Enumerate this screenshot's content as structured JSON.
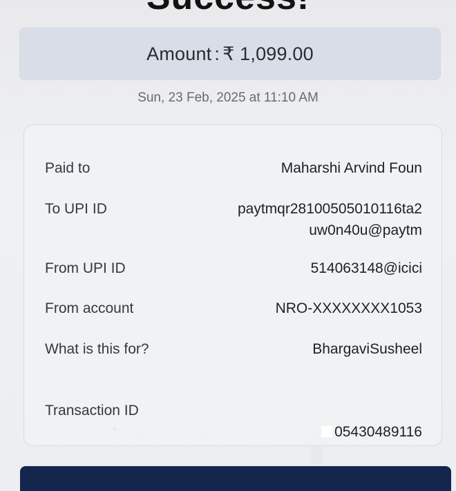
{
  "header": {
    "title": "Success!"
  },
  "summary": {
    "amount_label": "Amount",
    "amount_separator": ":",
    "amount_value": "₹ 1,099.00",
    "date_time": "Sun, 23 Feb, 2025 at 11:10 AM"
  },
  "details": {
    "paid_to_label": "Paid to",
    "paid_to_value": "Maharshi Arvind Foun",
    "to_upi_label": "To UPI ID",
    "to_upi_value": "paytmqr28100505010116ta2\nuw0n40u@paytm",
    "from_upi_label": "From UPI ID",
    "from_upi_value": "514063148@icici",
    "from_account_label": "From account",
    "from_account_value": "NRO-XXXXXXXX1053",
    "purpose_label": "What is this for?",
    "purpose_value": "BhargaviSusheel",
    "transaction_id_label": "Transaction ID",
    "transaction_id_value": "05430489116"
  }
}
